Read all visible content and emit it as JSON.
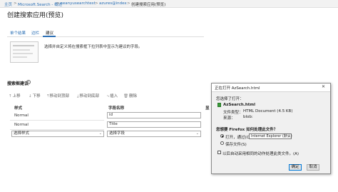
{
  "breadcrumb": {
    "items": [
      "主页",
      "Microsoft.Search - 概述",
      "seanyusearchtest",
      "azures@index",
      "创建搜索应用(预览)"
    ],
    "separator": ">"
  },
  "page_title": "创建搜索应用(预览)",
  "tabs": [
    {
      "label": "单个结果",
      "active": false
    },
    {
      "label": "边栏",
      "active": false
    },
    {
      "label": "建议",
      "active": true
    }
  ],
  "preview": {
    "description": "选择并自定义将在搜索框下拉列表中显示为建议的字段。"
  },
  "suggester": {
    "label": "搜索框建议",
    "info_icon": "i"
  },
  "toolbar": {
    "up": "上移",
    "down": "下移",
    "move_top": "移动到顶部",
    "move_bottom": "移动到底部",
    "insert": "插入",
    "delete": "删除"
  },
  "table": {
    "headers": {
      "style": "样式",
      "field_name": "字段名称",
      "extra": "显"
    },
    "rows": [
      {
        "style": "Normal",
        "field": "id"
      },
      {
        "style": "Normal",
        "field": "Title"
      }
    ],
    "new_row": {
      "style_placeholder": "选择样式",
      "field_placeholder": "选择字段"
    }
  },
  "dialog": {
    "title": "正在打开 AzSearch.html",
    "close": "✕",
    "you_chose": "您选择了打开：",
    "filename": "AzSearch.html",
    "file_type_label": "文件类型：",
    "file_type": "HTML Document (4.5 KB)",
    "source_label": "来源：",
    "source": "blob:",
    "question": "您想要 Firefox 如何处理此文件？",
    "open_with_label": "打开，通过(O)",
    "open_with_value": "Internet Explorer (默认)",
    "save_label": "保存文件(S)",
    "remember_label": "以后自动采用相同的动作处理此类文件。(A)",
    "ok": "确定",
    "cancel": "取消",
    "file_icon_color": "#3a9a3a",
    "primary_border_color": "#0078d7"
  }
}
